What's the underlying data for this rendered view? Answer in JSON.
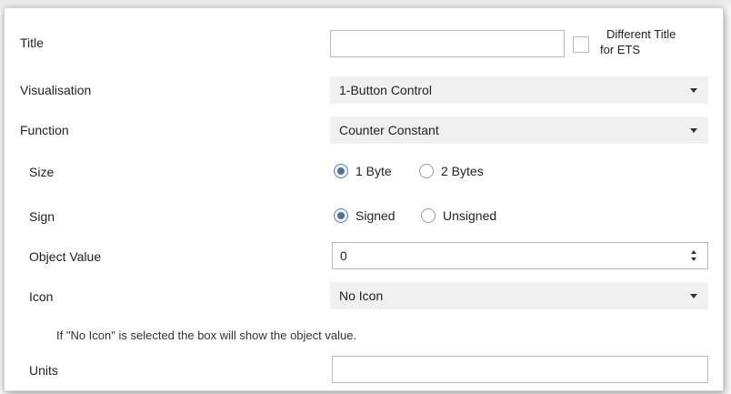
{
  "title_row": {
    "label": "Title",
    "value": "",
    "different_title_line1": "Different Title",
    "different_title_line2": "for ETS"
  },
  "visualisation": {
    "label": "Visualisation",
    "value": "1-Button Control"
  },
  "function": {
    "label": "Function",
    "value": "Counter Constant"
  },
  "size": {
    "label": "Size",
    "options": [
      "1 Byte",
      "2 Bytes"
    ],
    "selected": "1 Byte"
  },
  "sign": {
    "label": "Sign",
    "options": [
      "Signed",
      "Unsigned"
    ],
    "selected": "Signed"
  },
  "object_value": {
    "label": "Object Value",
    "value": "0"
  },
  "icon": {
    "label": "Icon",
    "value": "No Icon"
  },
  "note": "If \"No Icon\" is selected the box will show the object value.",
  "units": {
    "label": "Units",
    "value": ""
  }
}
